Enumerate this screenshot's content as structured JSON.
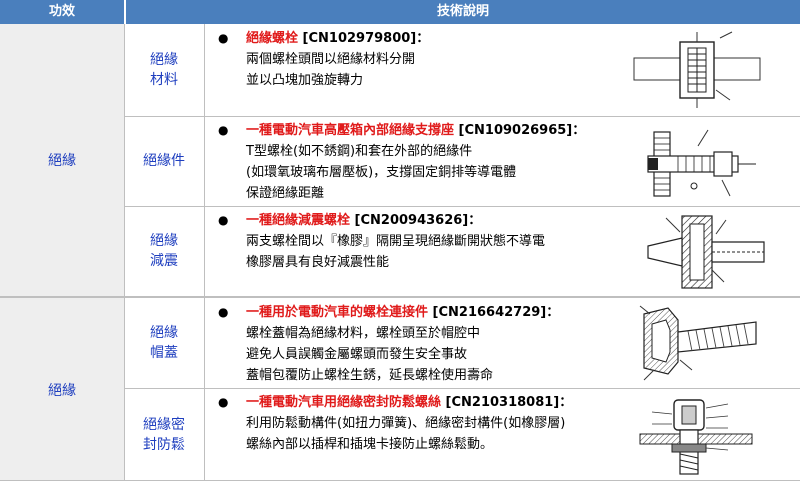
{
  "header": {
    "col1": "功效",
    "col2": "技術說明"
  },
  "groups": [
    {
      "label": "絕緣"
    },
    {
      "label": "絕緣"
    }
  ],
  "rows": [
    {
      "sub": "絕緣\n材料",
      "bullet": "●",
      "title_red": "絕緣螺栓",
      "title_rest": " [CN102979800]：",
      "lines": [
        "兩個螺栓頭間以絕緣材料分開",
        "並以凸塊加強旋轉力"
      ]
    },
    {
      "sub": "絕緣件",
      "bullet": "●",
      "title_red": "一種電動汽車高壓箱內部絕緣支撐座",
      "title_rest": " [CN109026965]：",
      "lines": [
        "T型螺栓(如不銹鋼)和套在外部的絕緣件",
        "(如環氧玻璃布層壓板)，支撐固定銅排等導電體",
        "保證絕緣距離"
      ]
    },
    {
      "sub": "絕緣\n減震",
      "bullet": "●",
      "title_red": "一種絕緣減震螺栓",
      "title_rest": " [CN200943626]：",
      "lines": [
        "兩支螺栓間以『橡膠』隔開呈現絕緣斷開狀態不導電",
        "橡膠層具有良好減震性能"
      ]
    },
    {
      "sub": "絕緣\n帽蓋",
      "bullet": "●",
      "title_red": "一種用於電動汽車的螺栓連接件",
      "title_rest": " [CN216642729]：",
      "lines": [
        "螺栓蓋帽為絕緣材料，螺栓頭至於帽腔中",
        "避免人員誤觸金屬螺頭而發生安全事故",
        "蓋帽包覆防止螺栓生銹，延長螺栓使用壽命"
      ]
    },
    {
      "sub": "絕緣密\n封防鬆",
      "bullet": "●",
      "title_red": "一種電動汽車用絕緣密封防鬆螺絲",
      "title_rest": " [CN210318081]：",
      "lines": [
        "利用防鬆動構件(如扭力彈簧)、絕緣密封構件(如橡膠層)",
        "螺絲內部以插桿和插塊卡接防止螺絲鬆動。"
      ]
    }
  ]
}
